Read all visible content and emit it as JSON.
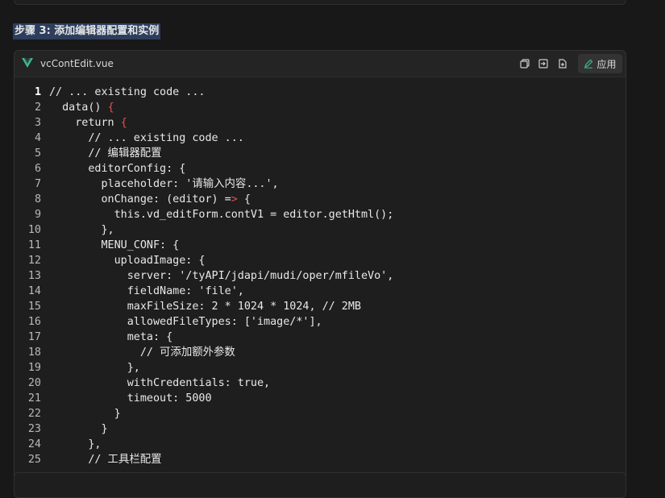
{
  "heading": "步骤 3: 添加编辑器配置和实例",
  "file": {
    "name": "vcContEdit.vue",
    "icon": "vue-icon"
  },
  "toolbar": {
    "copy_icon": "copy-icon",
    "insert_icon": "insert-icon",
    "new_file_icon": "new-file-icon",
    "apply_label": "应用",
    "apply_icon": "apply-icon"
  },
  "colors": {
    "background": "#181818",
    "card": "#1e1e1e",
    "heading_highlight": "#2c3e5c",
    "vue_green": "#41b883",
    "bracket_red": "#e05252"
  },
  "code_lines": [
    {
      "n": "1",
      "text": "// ... existing code ..."
    },
    {
      "n": "2",
      "text": "  data() ",
      "tail": "{"
    },
    {
      "n": "3",
      "text": "    return ",
      "tail": "{"
    },
    {
      "n": "4",
      "text": "      // ... existing code ..."
    },
    {
      "n": "5",
      "text": "      // 编辑器配置"
    },
    {
      "n": "6",
      "text": "      editorConfig: {"
    },
    {
      "n": "7",
      "text": "        placeholder: '请输入内容...',"
    },
    {
      "n": "8",
      "text": "        onChange: (editor) =",
      "tail": ">",
      "after": " {"
    },
    {
      "n": "9",
      "text": "          this.vd_editForm.contV1 = editor.getHtml();"
    },
    {
      "n": "10",
      "text": "        },"
    },
    {
      "n": "11",
      "text": "        MENU_CONF: {"
    },
    {
      "n": "12",
      "text": "          uploadImage: {"
    },
    {
      "n": "13",
      "text": "            server: '/tyAPI/jdapi/mudi/oper/mfileVo',"
    },
    {
      "n": "14",
      "text": "            fieldName: 'file',"
    },
    {
      "n": "15",
      "text": "            maxFileSize: 2 * 1024 * 1024, // 2MB"
    },
    {
      "n": "16",
      "text": "            allowedFileTypes: ['image/*'],"
    },
    {
      "n": "17",
      "text": "            meta: {"
    },
    {
      "n": "18",
      "text": "              // 可添加额外参数"
    },
    {
      "n": "19",
      "text": "            },"
    },
    {
      "n": "20",
      "text": "            withCredentials: true,"
    },
    {
      "n": "21",
      "text": "            timeout: 5000"
    },
    {
      "n": "22",
      "text": "          }"
    },
    {
      "n": "23",
      "text": "        }"
    },
    {
      "n": "24",
      "text": "      },"
    },
    {
      "n": "25",
      "text": "      // 工具栏配置"
    }
  ]
}
